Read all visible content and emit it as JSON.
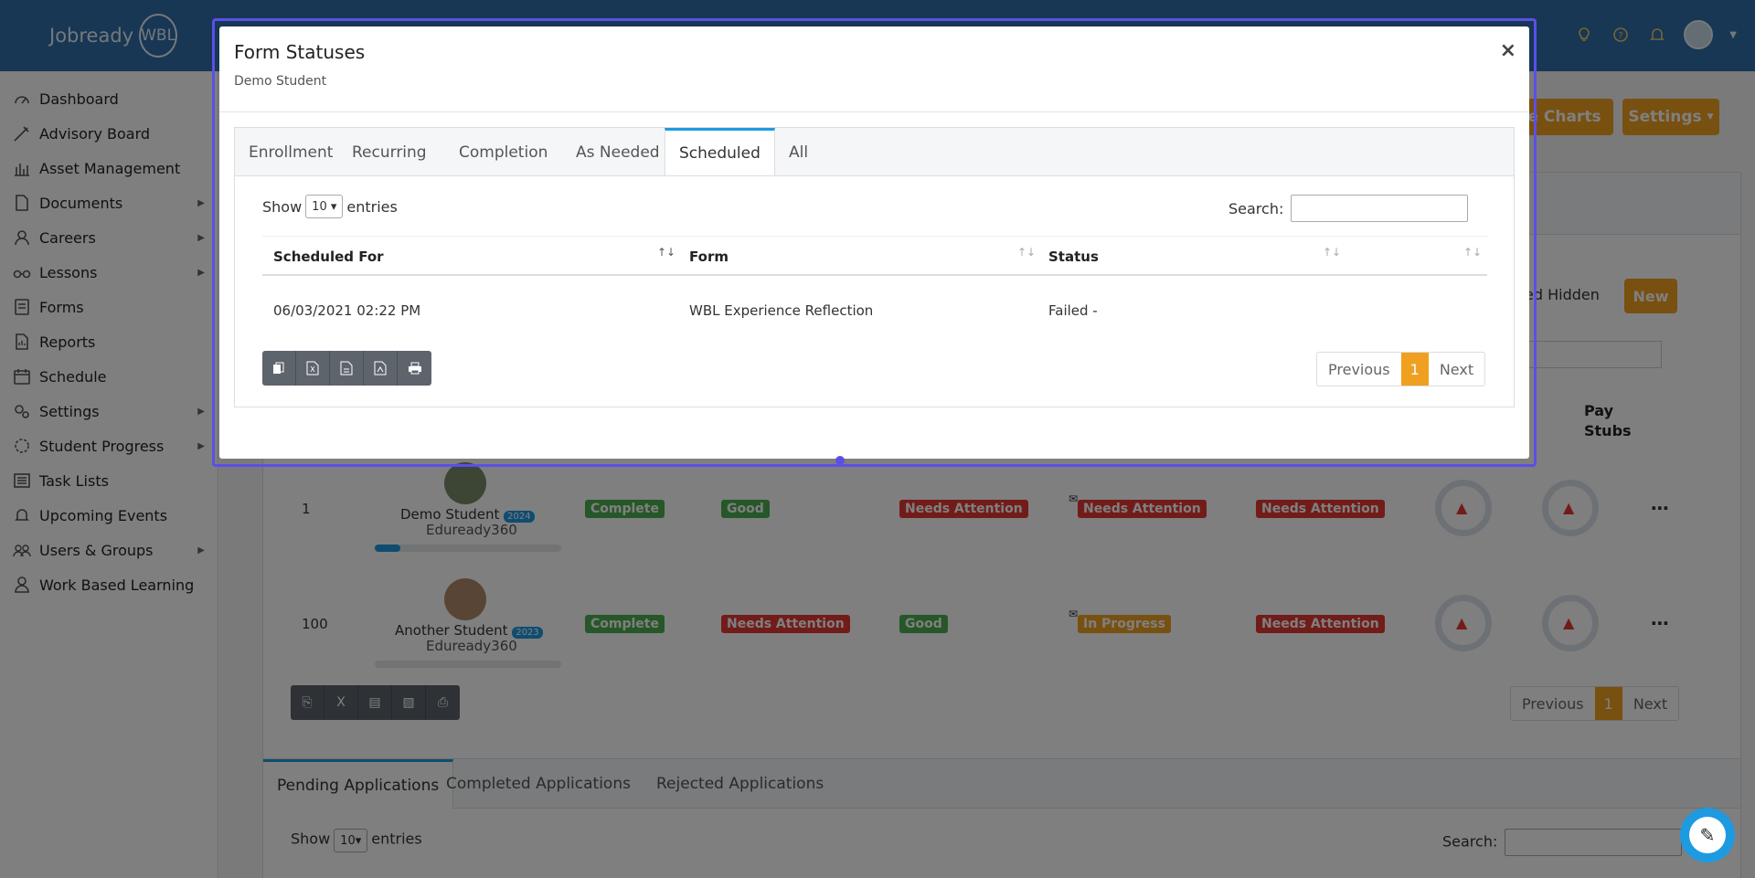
{
  "app": {
    "logo_text": "Jobready",
    "logo_badge": "WBL"
  },
  "sidebar": {
    "items": [
      {
        "label": "Dashboard",
        "icon": "gauge-icon",
        "submenu": false
      },
      {
        "label": "Advisory Board",
        "icon": "wand-icon",
        "submenu": false
      },
      {
        "label": "Asset Management",
        "icon": "chart-icon",
        "submenu": false
      },
      {
        "label": "Documents",
        "icon": "document-icon",
        "submenu": true
      },
      {
        "label": "Careers",
        "icon": "user-icon",
        "submenu": true
      },
      {
        "label": "Lessons",
        "icon": "glasses-icon",
        "submenu": true
      },
      {
        "label": "Forms",
        "icon": "form-icon",
        "submenu": false
      },
      {
        "label": "Reports",
        "icon": "report-icon",
        "submenu": false
      },
      {
        "label": "Schedule",
        "icon": "calendar-icon",
        "submenu": false
      },
      {
        "label": "Settings",
        "icon": "gears-icon",
        "submenu": true
      },
      {
        "label": "Student Progress",
        "icon": "progress-icon",
        "submenu": true
      },
      {
        "label": "Task Lists",
        "icon": "list-icon",
        "submenu": false
      },
      {
        "label": "Upcoming Events",
        "icon": "bell-icon",
        "submenu": false
      },
      {
        "label": "Users & Groups",
        "icon": "users-icon",
        "submenu": true
      },
      {
        "label": "Work Based Learning",
        "icon": "worker-icon",
        "submenu": false
      }
    ]
  },
  "background": {
    "charts_button": "gle Charts",
    "settings_button": "Settings",
    "hidden_text": "ed Hidden",
    "new_button": "New",
    "pay_stubs_header": "Pay Stubs",
    "rows": [
      {
        "id": "1",
        "name": "Demo Student",
        "year": "2024",
        "org": "Eduready360",
        "c1": "Complete",
        "c2": "Good",
        "c3": "Needs Attention",
        "c4": "Needs Attention",
        "c5": "Needs Attention"
      },
      {
        "id": "100",
        "name": "Another Student",
        "year": "2023",
        "org": "Eduready360",
        "c1": "Complete",
        "c2": "Needs Attention",
        "c3": "Good",
        "c4": "In Progress",
        "c5": "Needs Attention"
      }
    ],
    "pager": {
      "previous": "Previous",
      "page": "1",
      "next": "Next"
    },
    "app_tabs": [
      "Pending Applications",
      "Completed Applications",
      "Rejected Applications"
    ],
    "show_label": "Show",
    "entries_value": "10",
    "entries_label": "entries",
    "search_label": "Search:"
  },
  "modal": {
    "title": "Form Statuses",
    "subtitle": "Demo Student",
    "tabs": [
      "Enrollment",
      "Recurring",
      "Completion",
      "As Needed",
      "Scheduled",
      "All"
    ],
    "active_tab": "Scheduled",
    "show_label": "Show",
    "entries_value": "10",
    "entries_label": "entries",
    "search_label": "Search:",
    "columns": [
      "Scheduled For",
      "Form",
      "Status"
    ],
    "rows": [
      {
        "scheduled_for": "06/03/2021 02:22 PM",
        "form": "WBL Experience Reflection",
        "status": "Failed -"
      }
    ],
    "export_buttons": [
      "copy-icon",
      "excel-icon",
      "csv-icon",
      "pdf-icon",
      "print-icon"
    ],
    "pager": {
      "previous": "Previous",
      "page": "1",
      "next": "Next"
    }
  },
  "colors": {
    "topbar": "#2e6fa8",
    "accent": "#f0a020",
    "tab_active": "#1e9ae0",
    "focus_frame": "#5b4fe8"
  }
}
